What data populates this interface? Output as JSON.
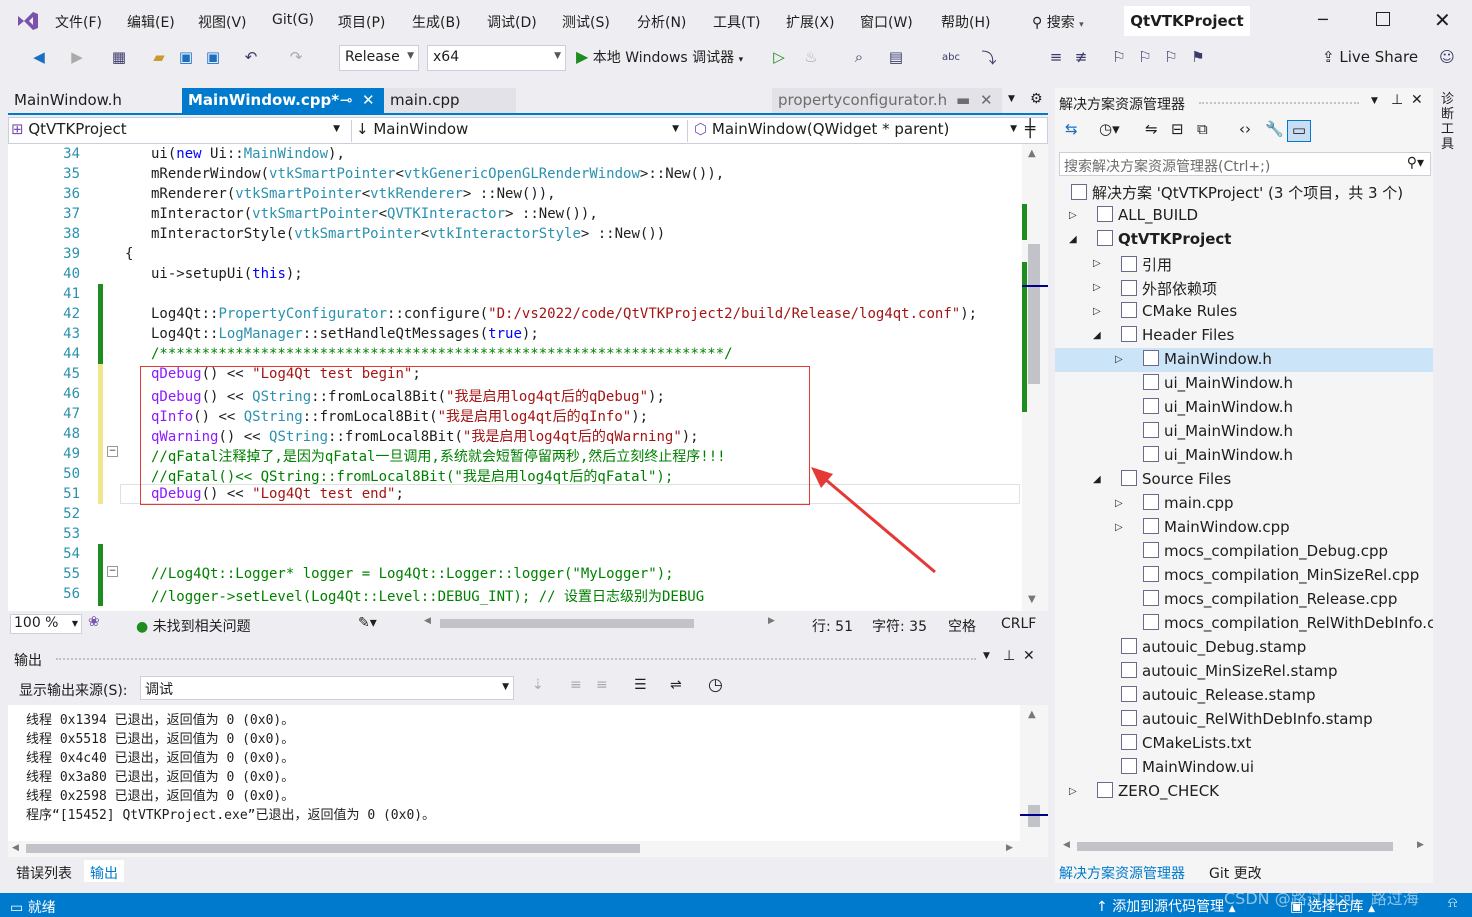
{
  "menu": [
    "文件(F)",
    "编辑(E)",
    "视图(V)",
    "Git(G)",
    "项目(P)",
    "生成(B)",
    "调试(D)",
    "测试(S)",
    "分析(N)",
    "工具(T)",
    "扩展(X)",
    "窗口(W)",
    "帮助(H)"
  ],
  "search_label": "搜索",
  "window_title": "QtVTKProject",
  "toolbar": {
    "config": "Release",
    "platform": "x64",
    "debugger": "本地 Windows 调试器",
    "live_share": "Live Share"
  },
  "tabs": [
    {
      "label": "MainWindow.h",
      "active": false
    },
    {
      "label": "MainWindow.cpp*",
      "active": true
    },
    {
      "label": "main.cpp",
      "active": false
    },
    {
      "label": "propertyconfigurator.h",
      "active": false
    }
  ],
  "nav": {
    "project": "QtVTKProject",
    "scope": "MainWindow",
    "member": "MainWindow(QWidget * parent)"
  },
  "code_lines": [
    {
      "n": "34",
      "t": "ui(new Ui::MainWindow),"
    },
    {
      "n": "35",
      "t": "mRenderWindow(vtkSmartPointer<vtkGenericOpenGLRenderWindow>::New()),"
    },
    {
      "n": "36",
      "t": "mRenderer(vtkSmartPointer<vtkRenderer> ::New()),"
    },
    {
      "n": "37",
      "t": "mInteractor(vtkSmartPointer<QVTKInteractor> ::New()),"
    },
    {
      "n": "38",
      "t": "mInteractorStyle(vtkSmartPointer<vtkInteractorStyle> ::New())"
    },
    {
      "n": "39",
      "t": "{"
    },
    {
      "n": "40",
      "t": "ui->setupUi(this);"
    },
    {
      "n": "41",
      "t": ""
    },
    {
      "n": "42",
      "t": "Log4Qt::PropertyConfigurator::configure(\"D:/vs2022/code/QtVTKProject2/build/Release/log4qt.conf\");"
    },
    {
      "n": "43",
      "t": "Log4Qt::LogManager::setHandleQtMessages(true);"
    },
    {
      "n": "44",
      "t": "/*******************************************************************/"
    },
    {
      "n": "45",
      "t": "qDebug() << \"Log4Qt test begin\";"
    },
    {
      "n": "46",
      "t": "qDebug() << QString::fromLocal8Bit(\"我是启用log4qt后的qDebug\");"
    },
    {
      "n": "47",
      "t": "qInfo() << QString::fromLocal8Bit(\"我是启用log4qt后的qInfo\");"
    },
    {
      "n": "48",
      "t": "qWarning() << QString::fromLocal8Bit(\"我是启用log4qt后的qWarning\");"
    },
    {
      "n": "49",
      "t": "//qFatal注释掉了,是因为qFatal一旦调用,系统就会短暂停留两秒,然后立刻终止程序!!!"
    },
    {
      "n": "50",
      "t": "//qFatal()<< QString::fromLocal8Bit(\"我是启用log4qt后的qFatal\");"
    },
    {
      "n": "51",
      "t": "qDebug() << \"Log4Qt test end\";"
    },
    {
      "n": "52",
      "t": ""
    },
    {
      "n": "53",
      "t": ""
    },
    {
      "n": "54",
      "t": ""
    },
    {
      "n": "55",
      "t": "//Log4Qt::Logger* logger = Log4Qt::Logger::logger(\"MyLogger\");"
    },
    {
      "n": "56",
      "t": "//logger->setLevel(Log4Qt::Level::DEBUG_INT); // 设置日志级别为DEBUG"
    }
  ],
  "editor_status": {
    "zoom": "100 %",
    "issues": "未找到相关问题",
    "line": "行: 51",
    "char": "字符: 35",
    "spaces": "空格",
    "eol": "CRLF"
  },
  "output": {
    "title": "输出",
    "source_label": "显示输出来源(S):",
    "source_value": "调试",
    "lines": [
      "线程 0x1394 已退出，返回值为 0 (0x0)。",
      "线程 0x5518 已退出，返回值为 0 (0x0)。",
      "线程 0x4c40 已退出，返回值为 0 (0x0)。",
      "线程 0x3a80 已退出，返回值为 0 (0x0)。",
      "线程 0x2598 已退出，返回值为 0 (0x0)。",
      "程序“[15452] QtVTKProject.exe”已退出，返回值为 0 (0x0)。"
    ]
  },
  "bottom_tabs": [
    "错误列表",
    "输出"
  ],
  "solution": {
    "title": "解决方案资源管理器",
    "search_placeholder": "搜索解决方案资源管理器(Ctrl+;)",
    "items": [
      {
        "label": "解决方案 'QtVTKProject' (3 个项目，共 3 个)",
        "level": 0,
        "exp": "",
        "bold": false
      },
      {
        "label": "ALL_BUILD",
        "level": 0,
        "exp": "▷",
        "bold": false
      },
      {
        "label": "QtVTKProject",
        "level": 0,
        "exp": "◢",
        "bold": true
      },
      {
        "label": "引用",
        "level": 1,
        "exp": "▷",
        "bold": false
      },
      {
        "label": "外部依赖项",
        "level": 1,
        "exp": "▷",
        "bold": false
      },
      {
        "label": "CMake Rules",
        "level": 1,
        "exp": "▷",
        "bold": false
      },
      {
        "label": "Header Files",
        "level": 1,
        "exp": "◢",
        "bold": false
      },
      {
        "label": "MainWindow.h",
        "level": 2,
        "exp": "▷",
        "bold": false
      },
      {
        "label": "ui_MainWindow.h",
        "level": 2,
        "exp": "",
        "bold": false
      },
      {
        "label": "ui_MainWindow.h",
        "level": 2,
        "exp": "",
        "bold": false
      },
      {
        "label": "ui_MainWindow.h",
        "level": 2,
        "exp": "",
        "bold": false
      },
      {
        "label": "ui_MainWindow.h",
        "level": 2,
        "exp": "",
        "bold": false
      },
      {
        "label": "Source Files",
        "level": 1,
        "exp": "◢",
        "bold": false
      },
      {
        "label": "main.cpp",
        "level": 2,
        "exp": "▷",
        "bold": false
      },
      {
        "label": "MainWindow.cpp",
        "level": 2,
        "exp": "▷",
        "bold": false
      },
      {
        "label": "mocs_compilation_Debug.cpp",
        "level": 2,
        "exp": "",
        "bold": false
      },
      {
        "label": "mocs_compilation_MinSizeRel.cpp",
        "level": 2,
        "exp": "",
        "bold": false
      },
      {
        "label": "mocs_compilation_Release.cpp",
        "level": 2,
        "exp": "",
        "bold": false
      },
      {
        "label": "mocs_compilation_RelWithDebInfo.c",
        "level": 2,
        "exp": "",
        "bold": false
      },
      {
        "label": "autouic_Debug.stamp",
        "level": 1,
        "exp": "",
        "bold": false
      },
      {
        "label": "autouic_MinSizeRel.stamp",
        "level": 1,
        "exp": "",
        "bold": false
      },
      {
        "label": "autouic_Release.stamp",
        "level": 1,
        "exp": "",
        "bold": false
      },
      {
        "label": "autouic_RelWithDebInfo.stamp",
        "level": 1,
        "exp": "",
        "bold": false
      },
      {
        "label": "CMakeLists.txt",
        "level": 1,
        "exp": "",
        "bold": false
      },
      {
        "label": "MainWindow.ui",
        "level": 1,
        "exp": "",
        "bold": false
      },
      {
        "label": "ZERO_CHECK",
        "level": 0,
        "exp": "▷",
        "bold": false
      }
    ],
    "bottom_tabs": [
      "解决方案资源管理器",
      "Git 更改"
    ]
  },
  "side_strip_label": "诊断工具",
  "statusbar": {
    "ready": "就绪",
    "source_control": "添加到源代码管理",
    "repo": "选择仓库",
    "watermark": "CSDN @路过山河，路过海"
  }
}
